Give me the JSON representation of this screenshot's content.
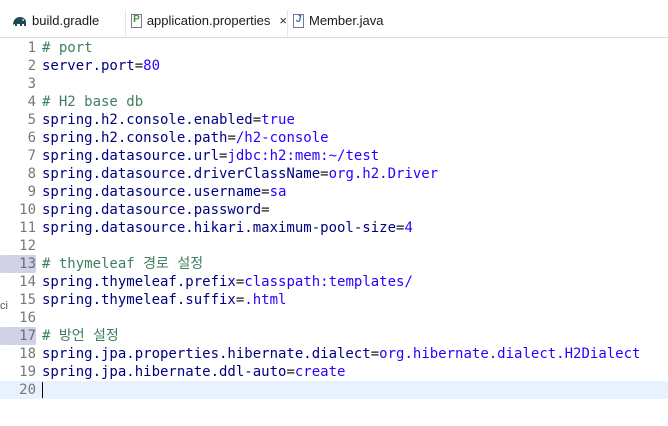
{
  "tabs": [
    {
      "label": "build.gradle",
      "icon": "gradle-elephant-icon",
      "active": false
    },
    {
      "label": "application.properties",
      "icon": "properties-file-icon",
      "active": true,
      "close": "×"
    },
    {
      "label": "Member.java",
      "icon": "java-file-icon",
      "active": false
    }
  ],
  "side_fragment": "ci",
  "lines": [
    {
      "n": "1",
      "kind": "comment",
      "text": "# port"
    },
    {
      "n": "2",
      "kind": "prop",
      "key": "server.port",
      "value": "80"
    },
    {
      "n": "3",
      "kind": "blank"
    },
    {
      "n": "4",
      "kind": "comment",
      "text": "# H2 base db"
    },
    {
      "n": "5",
      "kind": "prop",
      "key": "spring.h2.console.enabled",
      "value": "true"
    },
    {
      "n": "6",
      "kind": "prop",
      "key": "spring.h2.console.path",
      "value": "/h2-console"
    },
    {
      "n": "7",
      "kind": "prop",
      "key": "spring.datasource.url",
      "value": "jdbc:h2:mem:~/test"
    },
    {
      "n": "8",
      "kind": "prop",
      "key": "spring.datasource.driverClassName",
      "value": "org.h2.Driver"
    },
    {
      "n": "9",
      "kind": "prop",
      "key": "spring.datasource.username",
      "value": "sa"
    },
    {
      "n": "10",
      "kind": "prop",
      "key": "spring.datasource.password",
      "value": ""
    },
    {
      "n": "11",
      "kind": "prop",
      "key": "spring.datasource.hikari.maximum-pool-size",
      "value": "4"
    },
    {
      "n": "12",
      "kind": "blank"
    },
    {
      "n": "13",
      "kind": "comment",
      "text": "# thymeleaf 경로 설정",
      "folded": true
    },
    {
      "n": "14",
      "kind": "prop",
      "key": "spring.thymeleaf.prefix",
      "value": "classpath:templates/"
    },
    {
      "n": "15",
      "kind": "prop",
      "key": "spring.thymeleaf.suffix",
      "value": ".html"
    },
    {
      "n": "16",
      "kind": "blank"
    },
    {
      "n": "17",
      "kind": "comment",
      "text": "# 방언 설정",
      "folded": true
    },
    {
      "n": "18",
      "kind": "prop",
      "key": "spring.jpa.properties.hibernate.dialect",
      "value": "org.hibernate.dialect.H2Dialect"
    },
    {
      "n": "19",
      "kind": "prop",
      "key": "spring.jpa.hibernate.ddl-auto",
      "value": "create"
    },
    {
      "n": "20",
      "kind": "blank",
      "current": true
    }
  ]
}
